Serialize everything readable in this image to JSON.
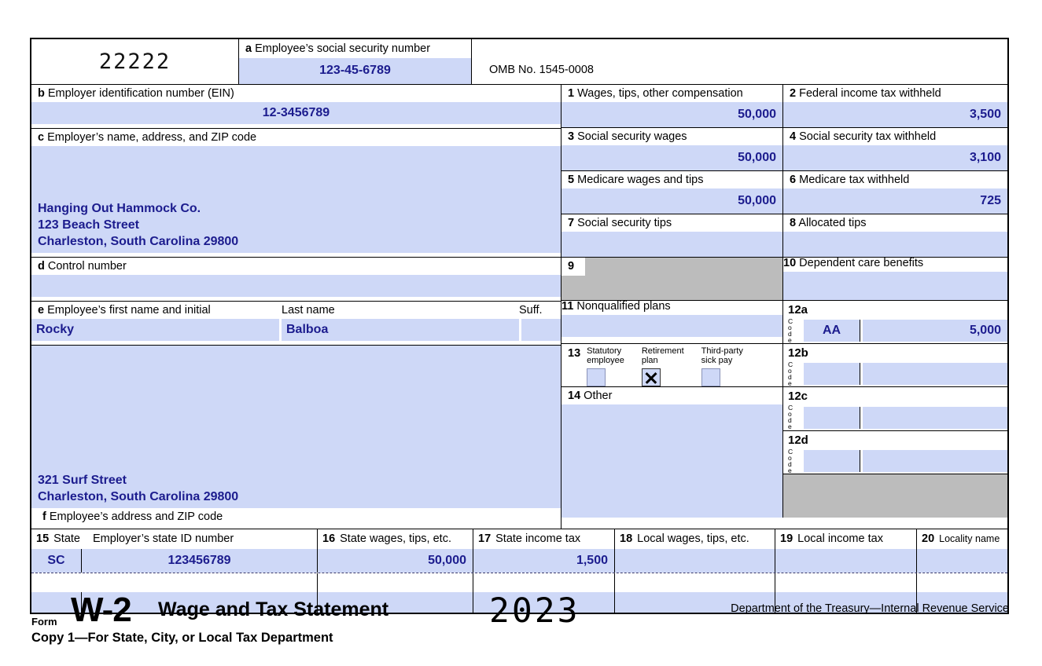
{
  "form": {
    "control_code": "22222",
    "omb": "OMB No. 1545-0008",
    "box_a": {
      "letter": "a",
      "label": "Employee’s social security number",
      "value": "123-45-6789"
    },
    "box_b": {
      "letter": "b",
      "label": "Employer identification number (EIN)",
      "value": "12-3456789"
    },
    "box_c": {
      "letter": "c",
      "label": "Employer’s name, address, and ZIP code",
      "line1": "Hanging Out Hammock Co.",
      "line2": "123 Beach Street",
      "line3": "Charleston, South Carolina 29800"
    },
    "box_d": {
      "letter": "d",
      "label": "Control number",
      "value": ""
    },
    "box_e": {
      "letter": "e",
      "label_first": "Employee’s first name and initial",
      "label_last": "Last name",
      "label_suff": "Suff.",
      "first_name": "Rocky",
      "last_name": "Balboa",
      "suffix": ""
    },
    "box_f": {
      "letter": "f",
      "label": "Employee’s address and ZIP code",
      "line1": "321 Surf Street",
      "line2": "Charleston, South Carolina 29800"
    },
    "box_1": {
      "num": "1",
      "label": "Wages, tips, other compensation",
      "value": "50,000"
    },
    "box_2": {
      "num": "2",
      "label": "Federal income tax withheld",
      "value": "3,500"
    },
    "box_3": {
      "num": "3",
      "label": "Social security wages",
      "value": "50,000"
    },
    "box_4": {
      "num": "4",
      "label": "Social security tax withheld",
      "value": "3,100"
    },
    "box_5": {
      "num": "5",
      "label": "Medicare wages and tips",
      "value": "50,000"
    },
    "box_6": {
      "num": "6",
      "label": "Medicare tax withheld",
      "value": "725"
    },
    "box_7": {
      "num": "7",
      "label": "Social security tips",
      "value": ""
    },
    "box_8": {
      "num": "8",
      "label": "Allocated tips",
      "value": ""
    },
    "box_9": {
      "num": "9",
      "label": "",
      "value": ""
    },
    "box_10": {
      "num": "10",
      "label": "Dependent care benefits",
      "value": ""
    },
    "box_11": {
      "num": "11",
      "label": "Nonqualified plans",
      "value": ""
    },
    "box_12a": {
      "num": "12a",
      "code_label": "Code",
      "code": "AA",
      "value": "5,000"
    },
    "box_12b": {
      "num": "12b",
      "code_label": "Code",
      "code": "",
      "value": ""
    },
    "box_12c": {
      "num": "12c",
      "code_label": "Code",
      "code": "",
      "value": ""
    },
    "box_12d": {
      "num": "12d",
      "code_label": "Code",
      "code": "",
      "value": ""
    },
    "box_13": {
      "num": "13",
      "statutory_line1": "Statutory",
      "statutory_line2": "employee",
      "statutory_checked": false,
      "retirement_line1": "Retirement",
      "retirement_line2": "plan",
      "retirement_checked": true,
      "sickpay_line1": "Third-party",
      "sickpay_line2": "sick pay",
      "sickpay_checked": false
    },
    "box_14": {
      "num": "14",
      "label": "Other",
      "value": ""
    },
    "box_15": {
      "num": "15",
      "label_state": "State",
      "label_id": "Employer’s state ID number",
      "state": "SC",
      "state_id": "123456789",
      "state2": "",
      "state_id2": ""
    },
    "box_16": {
      "num": "16",
      "label": "State wages, tips, etc.",
      "value": "50,000",
      "value2": ""
    },
    "box_17": {
      "num": "17",
      "label": "State income tax",
      "value": "1,500",
      "value2": ""
    },
    "box_18": {
      "num": "18",
      "label": "Local wages, tips, etc.",
      "value": "",
      "value2": ""
    },
    "box_19": {
      "num": "19",
      "label": "Local income tax",
      "value": "",
      "value2": ""
    },
    "box_20": {
      "num": "20",
      "label": "Locality name",
      "value": "",
      "value2": ""
    }
  },
  "footer": {
    "form_word": "Form",
    "form_number": "W-2",
    "title": "Wage and Tax Statement",
    "year": "2023",
    "department": "Department of the Treasury—Internal Revenue Service",
    "copy": "Copy 1—For State, City, or Local Tax Department"
  },
  "colors": {
    "field_blue": "#ced8f7",
    "value_navy": "#1c1c8e",
    "shaded_gray": "#bcbcbc",
    "rule_black": "#000000"
  }
}
